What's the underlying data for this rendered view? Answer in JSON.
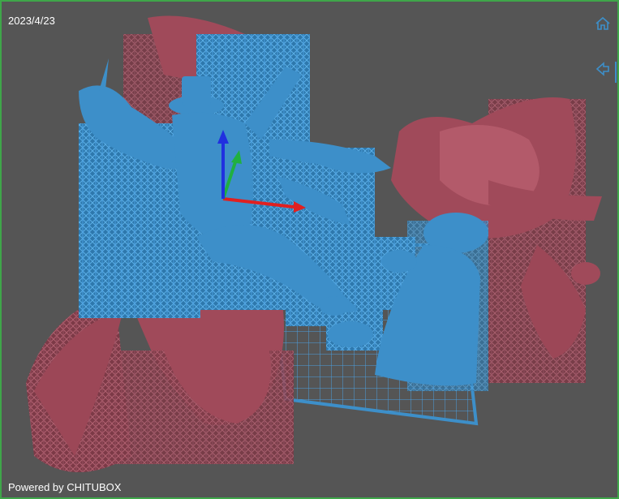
{
  "overlay": {
    "date": "2023/4/23",
    "brand": "Powered by CHITUBOX"
  },
  "nav": {
    "home_icon": "home-icon",
    "back_icon": "arrow-left-icon"
  },
  "colors": {
    "background": "#555555",
    "frame": "#3fa64a",
    "model_blue": "#3d8fc9",
    "model_red": "#a04a5a",
    "grid": "#4a9fe0",
    "axis_x": "#e02020",
    "axis_y": "#20b040",
    "axis_z": "#2030e0"
  }
}
